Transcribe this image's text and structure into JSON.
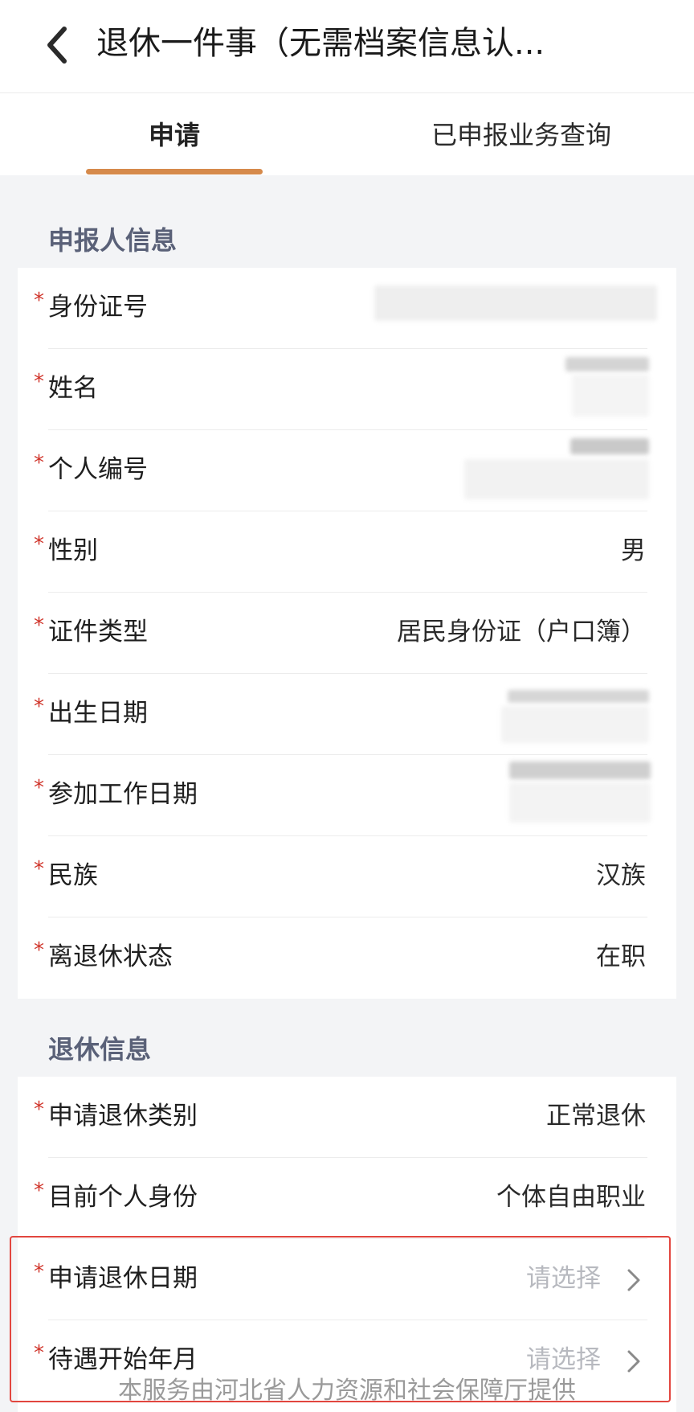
{
  "header": {
    "title": "退休一件事（无需档案信息认...",
    "back_icon": "chevron-left-icon"
  },
  "tabs": [
    {
      "label": "申请",
      "active": true
    },
    {
      "label": "已申报业务查询",
      "active": false
    }
  ],
  "applicant_section": {
    "title": "申报人信息",
    "rows": [
      {
        "label": "身份证号",
        "value": ""
      },
      {
        "label": "姓名",
        "value": ""
      },
      {
        "label": "个人编号",
        "value": ""
      },
      {
        "label": "性别",
        "value": "男"
      },
      {
        "label": "证件类型",
        "value": "居民身份证（户口簿）"
      },
      {
        "label": "出生日期",
        "value": ""
      },
      {
        "label": "参加工作日期",
        "value": ""
      },
      {
        "label": "民族",
        "value": "汉族"
      },
      {
        "label": "离退休状态",
        "value": "在职"
      }
    ]
  },
  "retire_section": {
    "title": "退休信息",
    "rows": [
      {
        "label": "申请退休类别",
        "value": "正常退休"
      },
      {
        "label": "目前个人身份",
        "value": "个体自由职业"
      },
      {
        "label": "申请退休日期",
        "placeholder": "请选择"
      },
      {
        "label": "待遇开始年月",
        "placeholder": "请选择"
      }
    ]
  },
  "required_mark": "*",
  "footer": {
    "text": "本服务由河北省人力资源和社会保障厅提供"
  },
  "colors": {
    "accent": "#d68a4b",
    "required": "#d0352b",
    "highlight": "#e2463f",
    "section_title": "#5a6178"
  }
}
